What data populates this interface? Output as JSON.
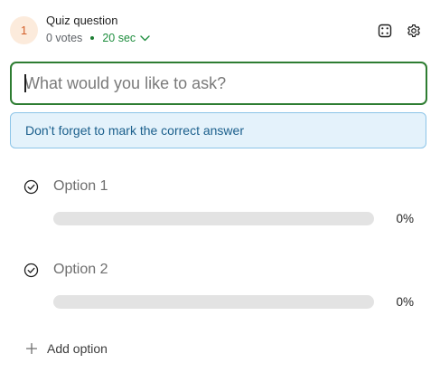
{
  "question": {
    "number": "1",
    "type_label": "Quiz question",
    "votes": "0 votes",
    "timer": "20 sec",
    "placeholder": "What would you like to ask?"
  },
  "info_banner": "Don’t forget to mark the correct answer",
  "options": [
    {
      "label": "Option 1",
      "percent_text": "0%",
      "percent": 0
    },
    {
      "label": "Option 2",
      "percent_text": "0%",
      "percent": 0
    }
  ],
  "add_option_label": "Add option",
  "colors": {
    "accent_green": "#2e7d32",
    "info_bg": "#e4f2fb",
    "info_text": "#1b5f8c",
    "badge_bg": "#fcebdc",
    "badge_text": "#d3602a"
  },
  "icons": {
    "timer_dropdown": "chevron-down-icon",
    "randomize": "dice-icon",
    "settings": "gear-icon",
    "mark_correct": "check-circle-icon",
    "add": "plus-icon"
  }
}
